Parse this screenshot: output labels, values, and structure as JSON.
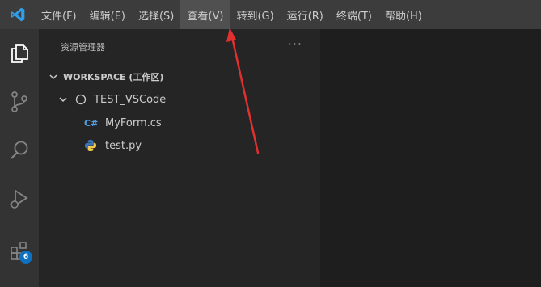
{
  "menubar": {
    "items": [
      {
        "label": "文件(F)"
      },
      {
        "label": "编辑(E)"
      },
      {
        "label": "选择(S)"
      },
      {
        "label": "查看(V)"
      },
      {
        "label": "转到(G)"
      },
      {
        "label": "运行(R)"
      },
      {
        "label": "终端(T)"
      },
      {
        "label": "帮助(H)"
      }
    ],
    "active_index": 3
  },
  "activitybar": {
    "icons": [
      {
        "name": "explorer-icon"
      },
      {
        "name": "source-control-icon"
      },
      {
        "name": "search-icon"
      },
      {
        "name": "run-debug-icon"
      },
      {
        "name": "extensions-icon"
      }
    ],
    "extensions_badge": "6"
  },
  "sidebar": {
    "title": "资源管理器",
    "more_label": "···",
    "workspace_label": "WORKSPACE (工作区)",
    "folder": {
      "name": "TEST_VSCode",
      "files": [
        {
          "name": "MyForm.cs",
          "icon": "csharp-file-icon",
          "icon_text": "C#"
        },
        {
          "name": "test.py",
          "icon": "python-file-icon"
        }
      ]
    }
  },
  "colors": {
    "menubar_bg": "#3c3c3c",
    "activitybar_bg": "#333333",
    "sidebar_bg": "#252526",
    "editor_bg": "#1e1e1e",
    "accent_blue": "#0e70c0",
    "annotation_arrow": "#e03030"
  }
}
